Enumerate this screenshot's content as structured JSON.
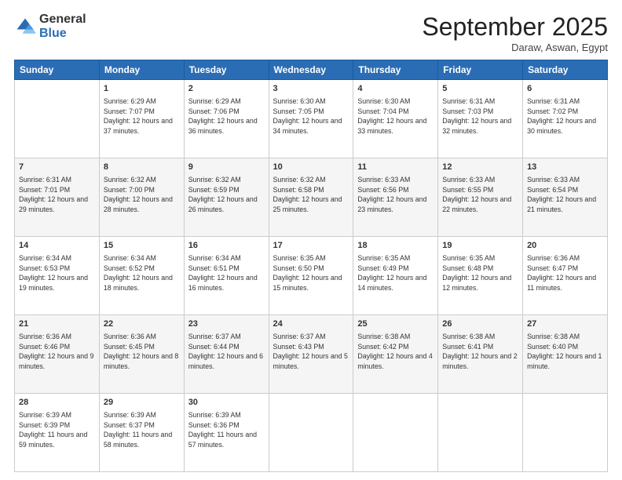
{
  "logo": {
    "general": "General",
    "blue": "Blue"
  },
  "header": {
    "month": "September 2025",
    "location": "Daraw, Aswan, Egypt"
  },
  "weekdays": [
    "Sunday",
    "Monday",
    "Tuesday",
    "Wednesday",
    "Thursday",
    "Friday",
    "Saturday"
  ],
  "weeks": [
    [
      {
        "day": "",
        "sunrise": "",
        "sunset": "",
        "daylight": ""
      },
      {
        "day": "1",
        "sunrise": "Sunrise: 6:29 AM",
        "sunset": "Sunset: 7:07 PM",
        "daylight": "Daylight: 12 hours and 37 minutes."
      },
      {
        "day": "2",
        "sunrise": "Sunrise: 6:29 AM",
        "sunset": "Sunset: 7:06 PM",
        "daylight": "Daylight: 12 hours and 36 minutes."
      },
      {
        "day": "3",
        "sunrise": "Sunrise: 6:30 AM",
        "sunset": "Sunset: 7:05 PM",
        "daylight": "Daylight: 12 hours and 34 minutes."
      },
      {
        "day": "4",
        "sunrise": "Sunrise: 6:30 AM",
        "sunset": "Sunset: 7:04 PM",
        "daylight": "Daylight: 12 hours and 33 minutes."
      },
      {
        "day": "5",
        "sunrise": "Sunrise: 6:31 AM",
        "sunset": "Sunset: 7:03 PM",
        "daylight": "Daylight: 12 hours and 32 minutes."
      },
      {
        "day": "6",
        "sunrise": "Sunrise: 6:31 AM",
        "sunset": "Sunset: 7:02 PM",
        "daylight": "Daylight: 12 hours and 30 minutes."
      }
    ],
    [
      {
        "day": "7",
        "sunrise": "Sunrise: 6:31 AM",
        "sunset": "Sunset: 7:01 PM",
        "daylight": "Daylight: 12 hours and 29 minutes."
      },
      {
        "day": "8",
        "sunrise": "Sunrise: 6:32 AM",
        "sunset": "Sunset: 7:00 PM",
        "daylight": "Daylight: 12 hours and 28 minutes."
      },
      {
        "day": "9",
        "sunrise": "Sunrise: 6:32 AM",
        "sunset": "Sunset: 6:59 PM",
        "daylight": "Daylight: 12 hours and 26 minutes."
      },
      {
        "day": "10",
        "sunrise": "Sunrise: 6:32 AM",
        "sunset": "Sunset: 6:58 PM",
        "daylight": "Daylight: 12 hours and 25 minutes."
      },
      {
        "day": "11",
        "sunrise": "Sunrise: 6:33 AM",
        "sunset": "Sunset: 6:56 PM",
        "daylight": "Daylight: 12 hours and 23 minutes."
      },
      {
        "day": "12",
        "sunrise": "Sunrise: 6:33 AM",
        "sunset": "Sunset: 6:55 PM",
        "daylight": "Daylight: 12 hours and 22 minutes."
      },
      {
        "day": "13",
        "sunrise": "Sunrise: 6:33 AM",
        "sunset": "Sunset: 6:54 PM",
        "daylight": "Daylight: 12 hours and 21 minutes."
      }
    ],
    [
      {
        "day": "14",
        "sunrise": "Sunrise: 6:34 AM",
        "sunset": "Sunset: 6:53 PM",
        "daylight": "Daylight: 12 hours and 19 minutes."
      },
      {
        "day": "15",
        "sunrise": "Sunrise: 6:34 AM",
        "sunset": "Sunset: 6:52 PM",
        "daylight": "Daylight: 12 hours and 18 minutes."
      },
      {
        "day": "16",
        "sunrise": "Sunrise: 6:34 AM",
        "sunset": "Sunset: 6:51 PM",
        "daylight": "Daylight: 12 hours and 16 minutes."
      },
      {
        "day": "17",
        "sunrise": "Sunrise: 6:35 AM",
        "sunset": "Sunset: 6:50 PM",
        "daylight": "Daylight: 12 hours and 15 minutes."
      },
      {
        "day": "18",
        "sunrise": "Sunrise: 6:35 AM",
        "sunset": "Sunset: 6:49 PM",
        "daylight": "Daylight: 12 hours and 14 minutes."
      },
      {
        "day": "19",
        "sunrise": "Sunrise: 6:35 AM",
        "sunset": "Sunset: 6:48 PM",
        "daylight": "Daylight: 12 hours and 12 minutes."
      },
      {
        "day": "20",
        "sunrise": "Sunrise: 6:36 AM",
        "sunset": "Sunset: 6:47 PM",
        "daylight": "Daylight: 12 hours and 11 minutes."
      }
    ],
    [
      {
        "day": "21",
        "sunrise": "Sunrise: 6:36 AM",
        "sunset": "Sunset: 6:46 PM",
        "daylight": "Daylight: 12 hours and 9 minutes."
      },
      {
        "day": "22",
        "sunrise": "Sunrise: 6:36 AM",
        "sunset": "Sunset: 6:45 PM",
        "daylight": "Daylight: 12 hours and 8 minutes."
      },
      {
        "day": "23",
        "sunrise": "Sunrise: 6:37 AM",
        "sunset": "Sunset: 6:44 PM",
        "daylight": "Daylight: 12 hours and 6 minutes."
      },
      {
        "day": "24",
        "sunrise": "Sunrise: 6:37 AM",
        "sunset": "Sunset: 6:43 PM",
        "daylight": "Daylight: 12 hours and 5 minutes."
      },
      {
        "day": "25",
        "sunrise": "Sunrise: 6:38 AM",
        "sunset": "Sunset: 6:42 PM",
        "daylight": "Daylight: 12 hours and 4 minutes."
      },
      {
        "day": "26",
        "sunrise": "Sunrise: 6:38 AM",
        "sunset": "Sunset: 6:41 PM",
        "daylight": "Daylight: 12 hours and 2 minutes."
      },
      {
        "day": "27",
        "sunrise": "Sunrise: 6:38 AM",
        "sunset": "Sunset: 6:40 PM",
        "daylight": "Daylight: 12 hours and 1 minute."
      }
    ],
    [
      {
        "day": "28",
        "sunrise": "Sunrise: 6:39 AM",
        "sunset": "Sunset: 6:39 PM",
        "daylight": "Daylight: 11 hours and 59 minutes."
      },
      {
        "day": "29",
        "sunrise": "Sunrise: 6:39 AM",
        "sunset": "Sunset: 6:37 PM",
        "daylight": "Daylight: 11 hours and 58 minutes."
      },
      {
        "day": "30",
        "sunrise": "Sunrise: 6:39 AM",
        "sunset": "Sunset: 6:36 PM",
        "daylight": "Daylight: 11 hours and 57 minutes."
      },
      {
        "day": "",
        "sunrise": "",
        "sunset": "",
        "daylight": ""
      },
      {
        "day": "",
        "sunrise": "",
        "sunset": "",
        "daylight": ""
      },
      {
        "day": "",
        "sunrise": "",
        "sunset": "",
        "daylight": ""
      },
      {
        "day": "",
        "sunrise": "",
        "sunset": "",
        "daylight": ""
      }
    ]
  ]
}
